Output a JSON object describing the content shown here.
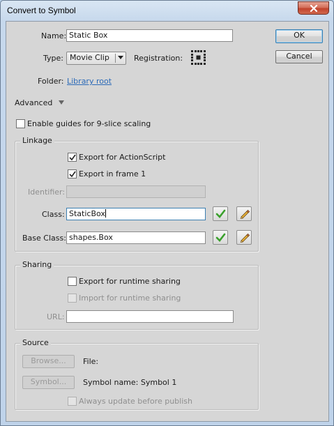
{
  "window": {
    "title": "Convert to Symbol"
  },
  "form": {
    "name_label": "Name:",
    "name_value": "Static Box",
    "type_label": "Type:",
    "type_value": "Movie Clip",
    "registration_label": "Registration:",
    "folder_label": "Folder:",
    "folder_link": "Library root",
    "advanced_label": "Advanced",
    "nine_slice_label": "Enable guides for 9-slice scaling"
  },
  "buttons": {
    "ok": "OK",
    "cancel": "Cancel",
    "browse": "Browse...",
    "symbol": "Symbol..."
  },
  "linkage": {
    "title": "Linkage",
    "export_actionscript": "Export for ActionScript",
    "export_frame1": "Export in frame 1",
    "identifier_label": "Identifier:",
    "identifier_value": "",
    "class_label": "Class:",
    "class_value": "StaticBox",
    "base_class_label": "Base Class:",
    "base_class_value": "shapes.Box"
  },
  "sharing": {
    "title": "Sharing",
    "export_runtime": "Export for runtime sharing",
    "import_runtime": "Import for runtime sharing",
    "url_label": "URL:",
    "url_value": ""
  },
  "source": {
    "title": "Source",
    "file_label": "File:",
    "symbol_name_label": "Symbol name: Symbol 1",
    "always_update": "Always update before publish"
  },
  "state": {
    "nine_slice_checked": false,
    "export_actionscript_checked": true,
    "export_frame1_checked": true,
    "export_runtime_checked": false,
    "import_runtime_checked": false,
    "always_update_checked": false
  },
  "icons": {
    "close": "close-icon",
    "validate": "checkmark-icon",
    "edit": "pencil-icon",
    "registration": "registration-grid-icon",
    "advanced": "triangle-down-icon"
  },
  "colors": {
    "window_bg": "#d6d6d6",
    "link": "#2d6bb8",
    "close_button": "#c2432d",
    "checkmark_green": "#3aa02c"
  }
}
